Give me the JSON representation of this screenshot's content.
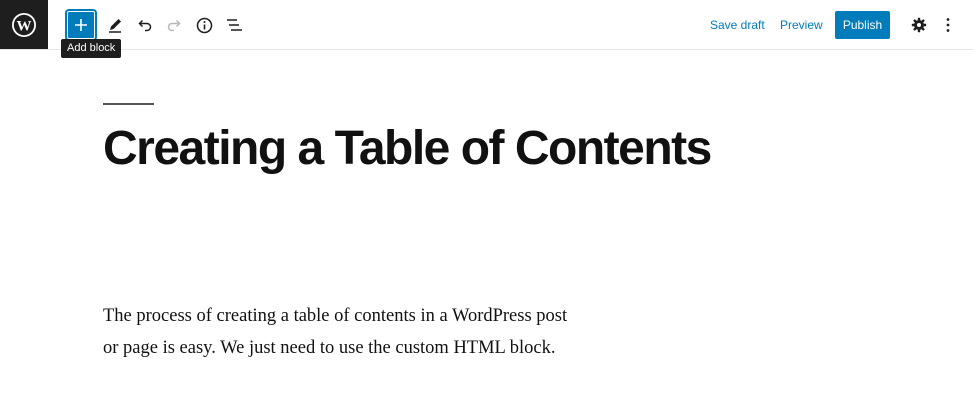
{
  "toolbar": {
    "add_block_tooltip": "Add block",
    "save_draft_label": "Save draft",
    "preview_label": "Preview",
    "publish_label": "Publish",
    "accent_color": "#007cba",
    "icons": [
      "wordpress-logo-icon",
      "plus-icon",
      "pencil-icon",
      "undo-icon",
      "redo-icon",
      "info-icon",
      "list-view-icon",
      "gear-icon",
      "more-vertical-icon"
    ]
  },
  "post": {
    "title": "Creating a Table of Contents",
    "paragraph_line_1": "The process of creating a table of contents in a WordPress post",
    "paragraph_line_2": "or page is easy. We just need to use the custom HTML block."
  }
}
